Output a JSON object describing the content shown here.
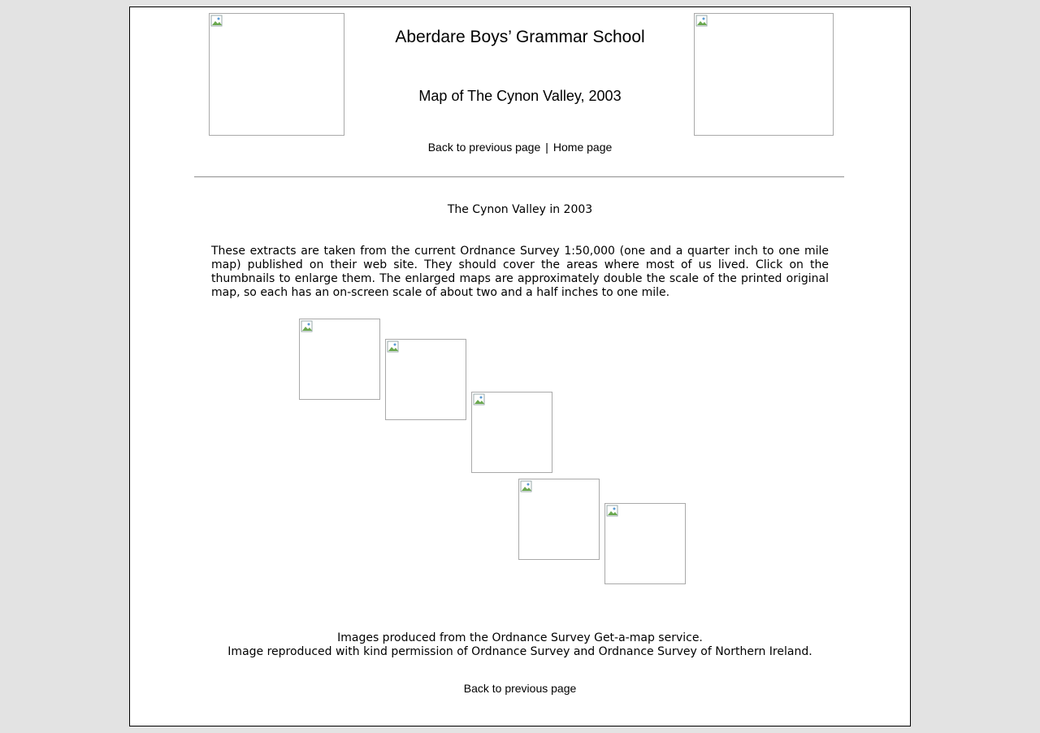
{
  "header": {
    "title": "Aberdare Boys’ Grammar School",
    "subtitle": "Map of The Cynon Valley, 2003"
  },
  "nav": {
    "back_label": "Back to previous page",
    "separator": "|",
    "home_label": "Home page"
  },
  "content": {
    "heading": "The Cynon Valley in 2003",
    "intro": "These extracts are taken from the current Ordnance Survey 1:50,000 (one and a quarter inch to one mile map) published on their web site. They should cover the areas where most of us lived. Click on the thumbnails to enlarge them. The enlarged maps are approximately double the scale of the printed original map, so each has an on-screen scale of about two and a half inches to one mile."
  },
  "credits": {
    "line1": "Images produced from the Ordnance Survey Get-a-map service.",
    "line2": "Image reproduced with kind permission of Ordnance Survey and Ordnance Survey of Northern Ireland."
  },
  "footer": {
    "back_label": "Back to previous page"
  },
  "icons": {
    "broken_image": "broken-image-icon"
  }
}
